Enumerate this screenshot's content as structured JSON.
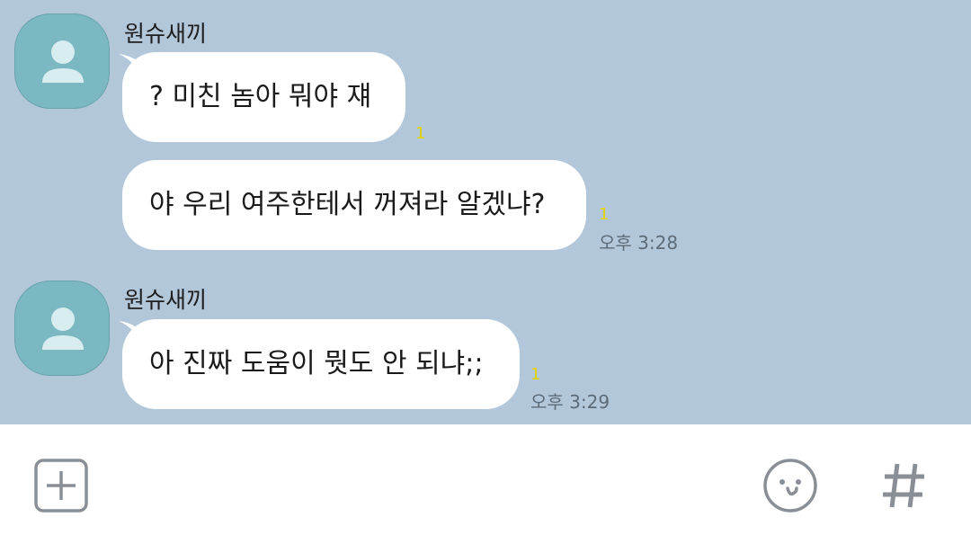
{
  "chat": {
    "messages": [
      {
        "sender": "원슈새끼",
        "bubbles": [
          {
            "text": "? 미친 놈아 뭐야 쟤",
            "unread": "1",
            "time": ""
          },
          {
            "text": "야 우리 여주한테서 꺼져라 알겠냐?",
            "unread": "1",
            "time": "오후 3:28"
          }
        ]
      },
      {
        "sender": "원슈새끼",
        "bubbles": [
          {
            "text": "아 진짜 도움이 뭣도 안 되냐;;",
            "unread": "1",
            "time": "오후 3:29"
          }
        ]
      }
    ]
  },
  "input_bar": {
    "add_icon": "plus-square-icon",
    "emoji_icon": "smiley-icon",
    "hash_icon": "hash-icon",
    "hash_glyph": "#"
  },
  "colors": {
    "chat_background": "#b2c7da",
    "bubble": "#ffffff",
    "avatar": "#7bb8c2",
    "unread": "#e3d400",
    "icon_gray": "#8a8f95"
  }
}
